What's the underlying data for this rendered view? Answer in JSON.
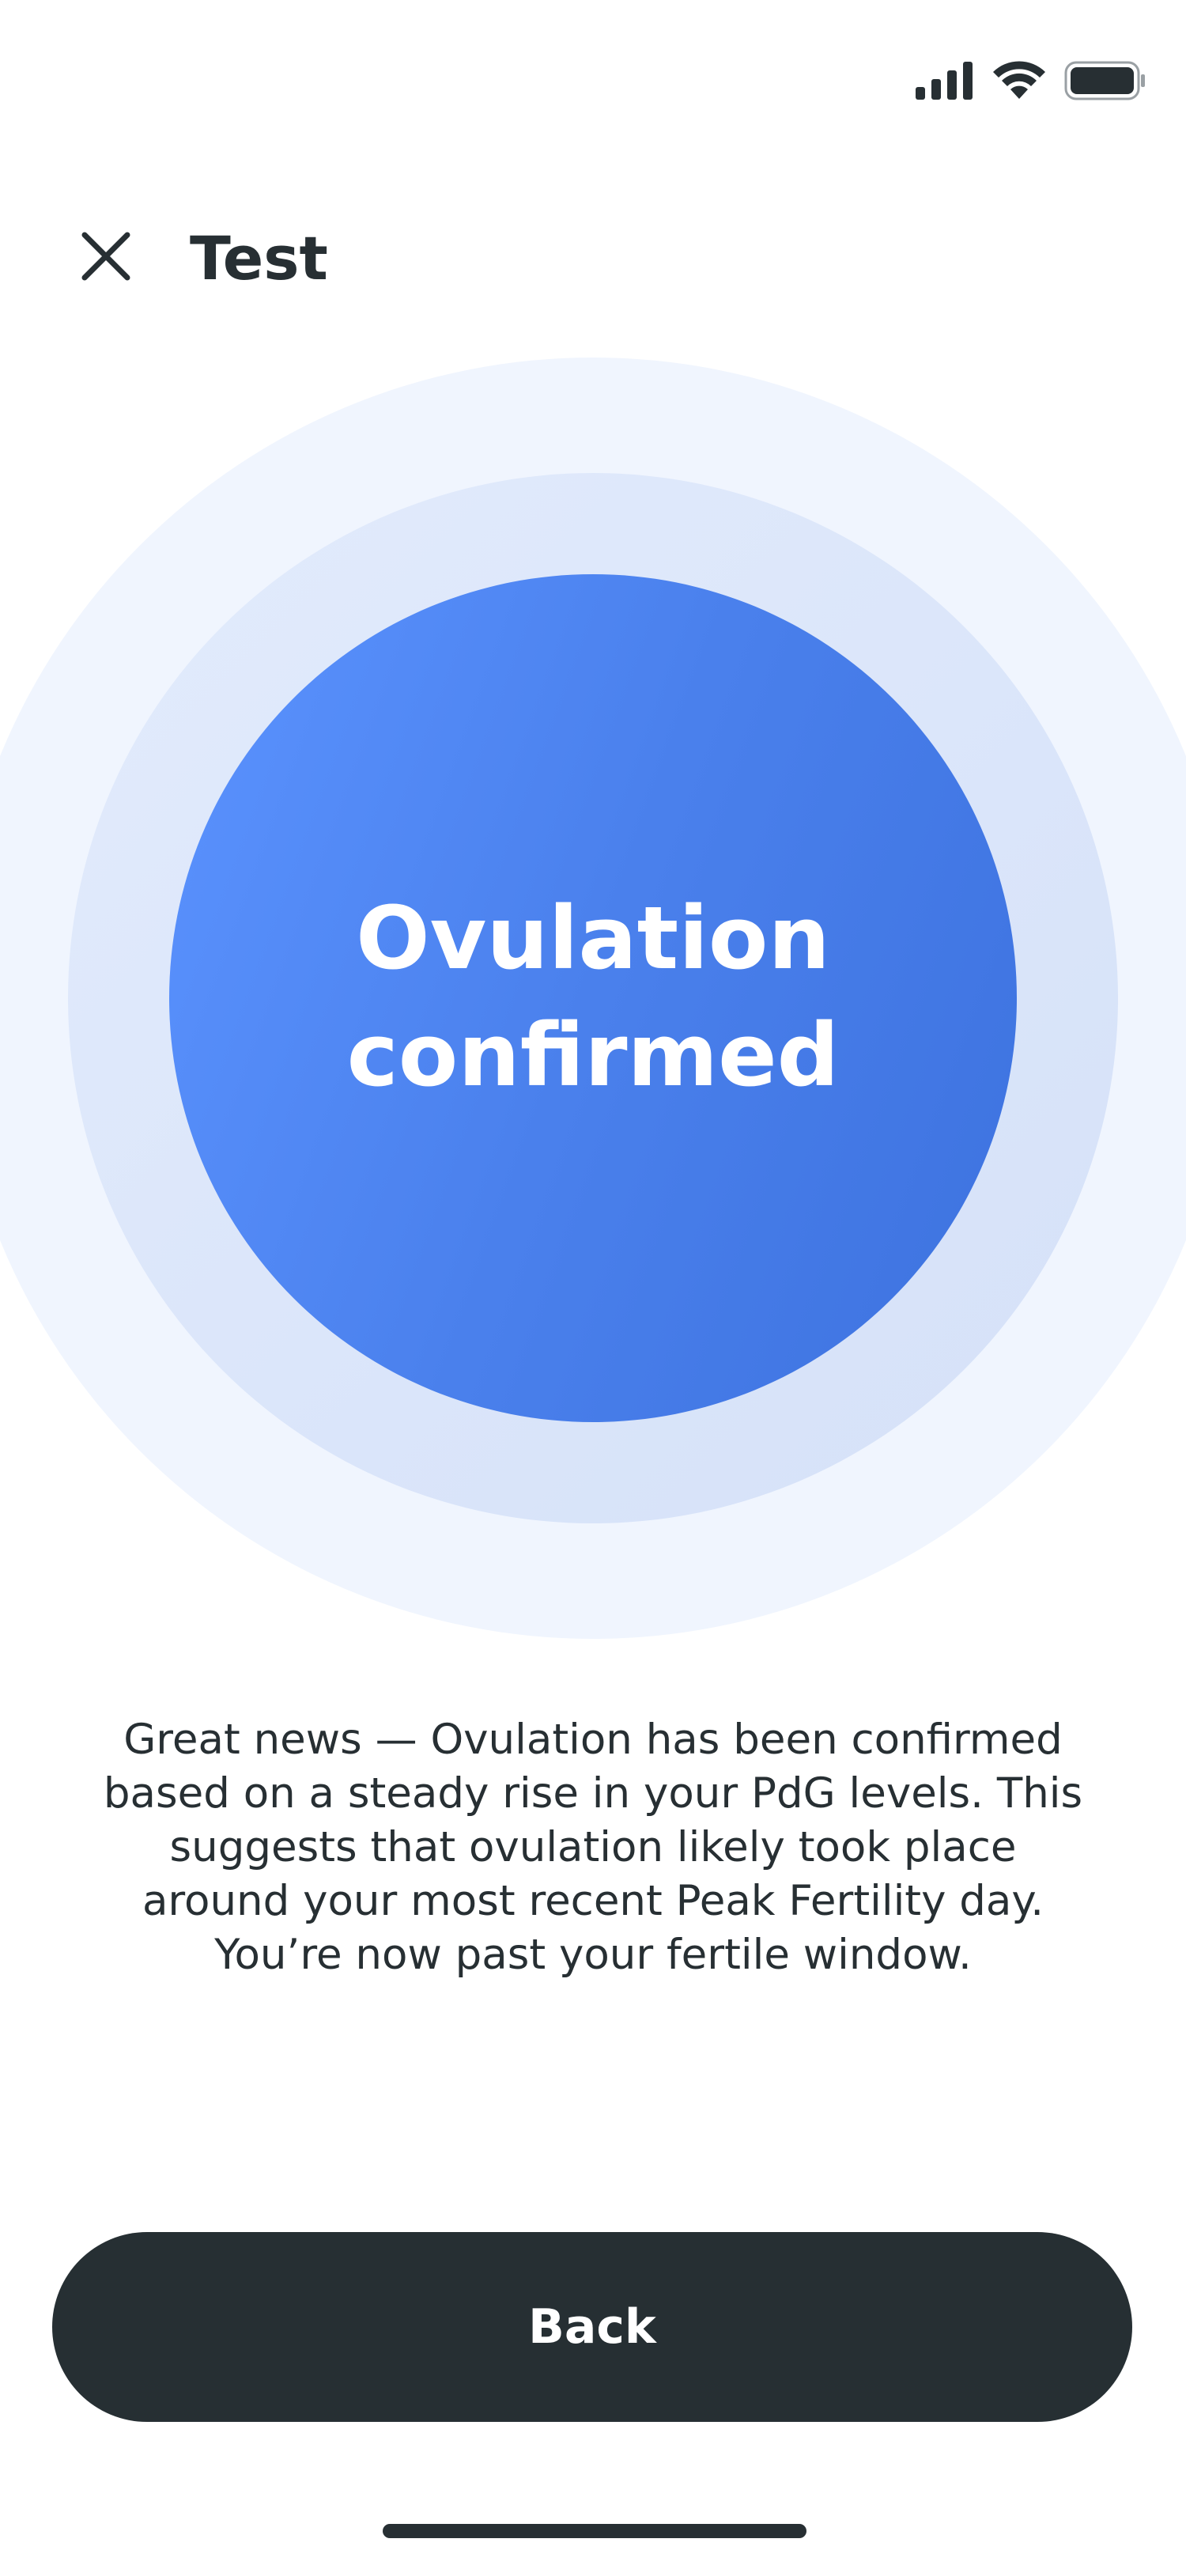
{
  "status_bar": {
    "icons": [
      "signal-icon",
      "wifi-icon",
      "battery-icon"
    ]
  },
  "header": {
    "close_icon": "close-icon",
    "title": "Test"
  },
  "result": {
    "title": "Ovulation confirmed",
    "description": "Great news — Ovulation has been confirmed based on a steady rise in your PdG levels. This suggests that ovulation likely took place around your most recent Peak Fertility day. You’re now past your fertile window."
  },
  "actions": {
    "back_label": "Back"
  },
  "colors": {
    "primary_blue": "#4a80ec",
    "ring_light": "#f0f5fe",
    "ring_mid": "#dbe5fa",
    "dark": "#262f33",
    "background": "#ffffff"
  }
}
